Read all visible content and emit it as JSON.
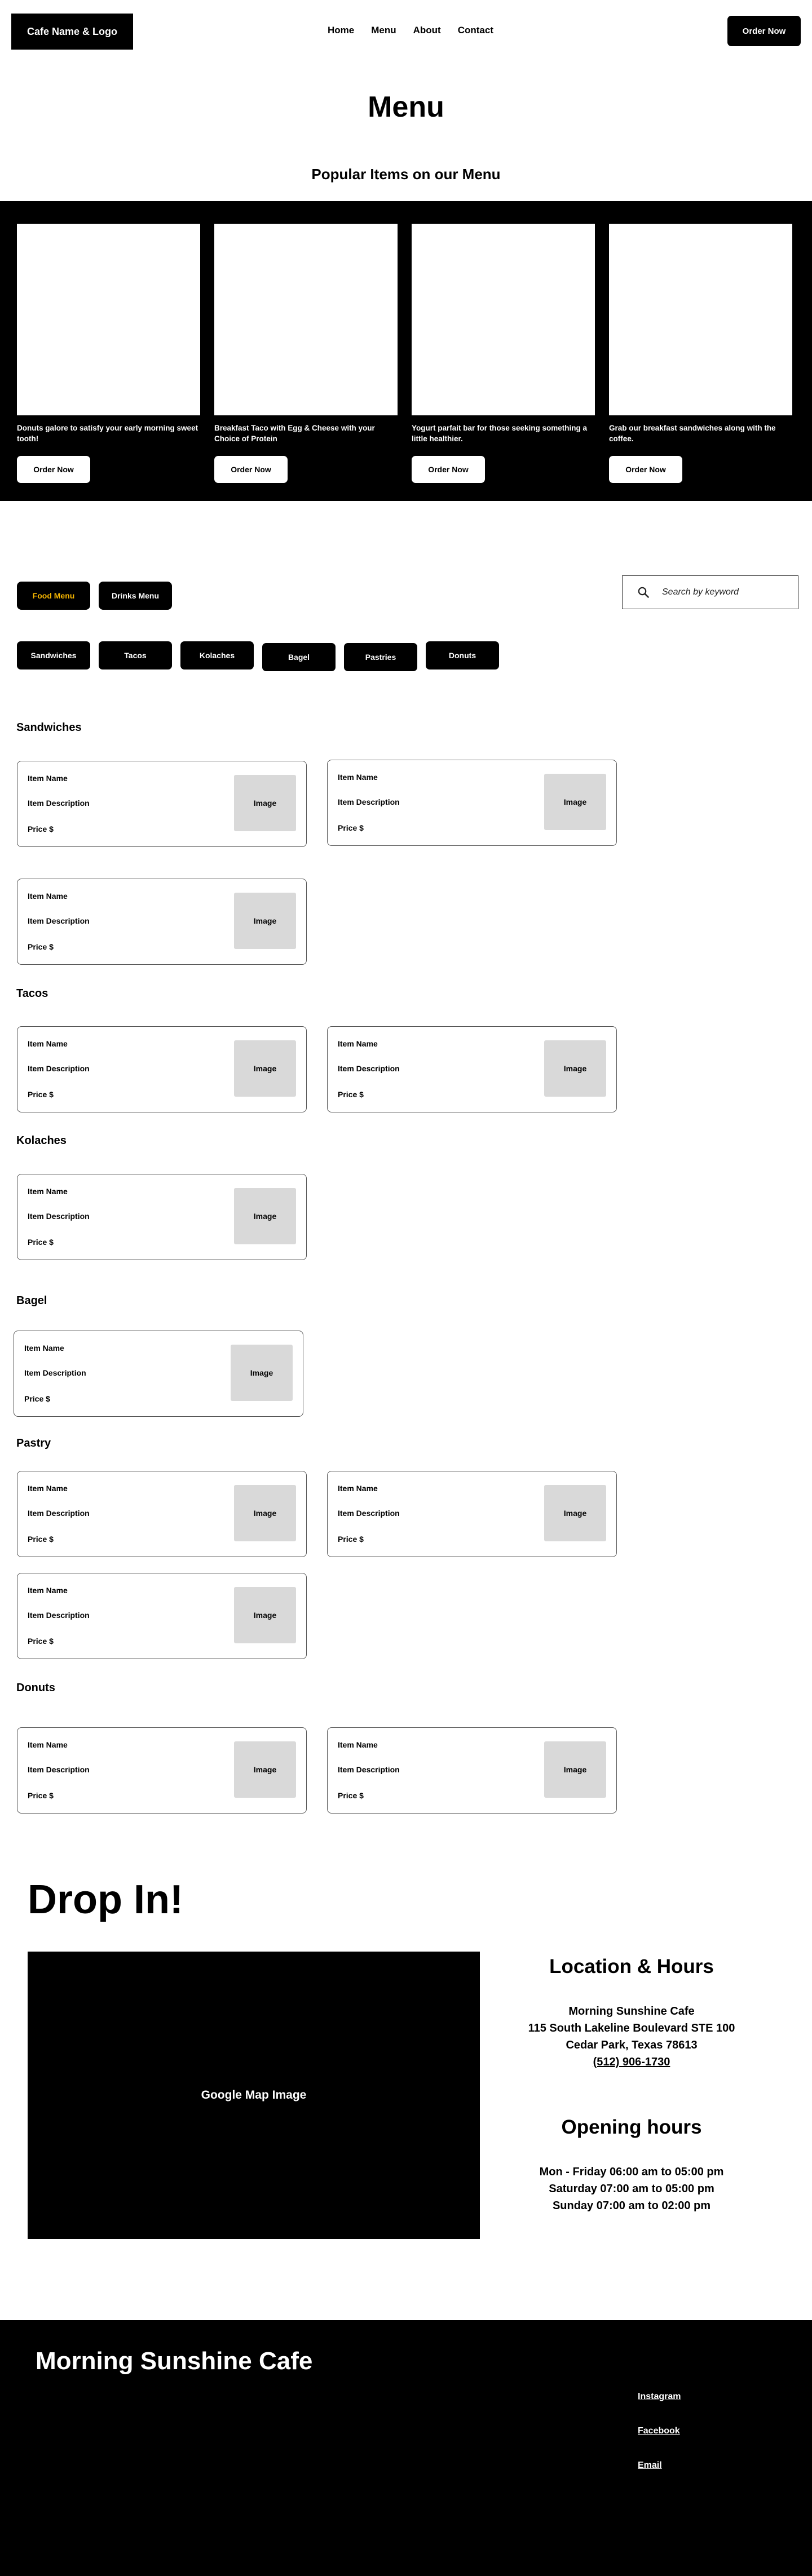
{
  "header": {
    "logo_text": "Cafe Name & Logo",
    "nav": [
      "Home",
      "Menu",
      "About",
      "Contact"
    ],
    "order_button": "Order Now"
  },
  "page_title": "Menu",
  "popular": {
    "title": "Popular Items on our Menu",
    "items": [
      {
        "description": "Donuts galore to satisfy your early morning sweet tooth!",
        "button": "Order Now"
      },
      {
        "description": "Breakfast Taco with Egg & Cheese with your Choice of Protein",
        "button": "Order Now"
      },
      {
        "description": "Yogurt parfait bar for those seeking something a little healthier.",
        "button": "Order Now"
      },
      {
        "description": "Grab our breakfast sandwiches along with the coffee.",
        "button": "Order Now"
      }
    ]
  },
  "menu_toggles": {
    "food": "Food Menu",
    "drinks": "Drinks Menu",
    "food_color": "#f4b400"
  },
  "search": {
    "placeholder": "Search by keyword"
  },
  "categories": [
    "Sandwiches",
    "Tacos",
    "Kolaches",
    "Bagel",
    "Pastries",
    "Donuts"
  ],
  "sections": {
    "sandwiches": "Sandwiches",
    "tacos": "Tacos",
    "kolaches": "Kolaches",
    "bagel": "Bagel",
    "pastry": "Pastry",
    "donuts": "Donuts"
  },
  "item_template": {
    "name": "Item Name",
    "description": "Item Description",
    "price": "Price $",
    "image": "Image"
  },
  "drop_in": {
    "title": "Drop In!",
    "map_label": "Google Map Image",
    "location_heading": "Location & Hours",
    "cafe_name": "Morning Sunshine Cafe",
    "address_line1": "115 South Lakeline Boulevard STE 100",
    "address_line2": "Cedar Park, Texas 78613",
    "phone": "(512) 906-1730",
    "hours_heading": "Opening hours",
    "hours": [
      "Mon - Friday 06:00 am to 05:00 pm",
      "Saturday 07:00 am to 05:00 pm",
      "Sunday 07:00 am to 02:00 pm"
    ]
  },
  "footer": {
    "name": "Morning Sunshine Cafe",
    "links": [
      "Instagram",
      "Facebook",
      "Email"
    ]
  }
}
